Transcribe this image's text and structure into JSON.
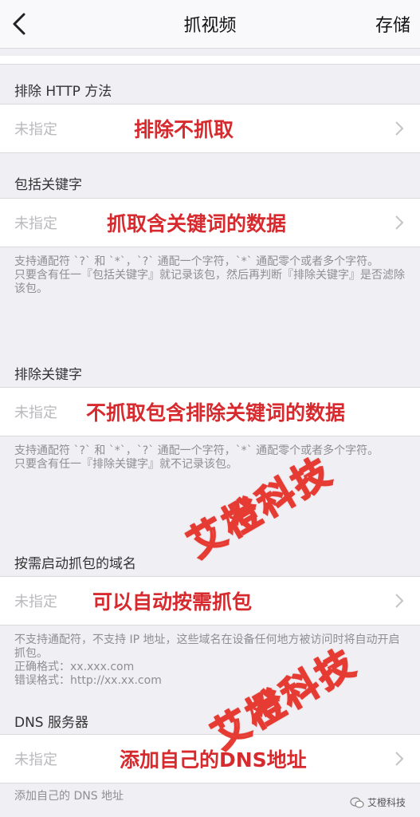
{
  "nav": {
    "title": "抓视频",
    "save_label": "存储"
  },
  "sections": [
    {
      "header": "排除 HTTP 方法",
      "placeholder": "未指定",
      "annotation": "排除不抓取",
      "note": ""
    },
    {
      "header": "包括关键字",
      "placeholder": "未指定",
      "annotation": "抓取含关键词的数据",
      "note": "支持通配符 `?` 和 `*`，`?` 通配一个字符，`*` 通配零个或者多个字符。\n只要含有任一『包括关键字』就记录该包，然后再判断『排除关键字』是否滤除该包。"
    },
    {
      "header": "排除关键字",
      "placeholder": "未指定",
      "annotation": "不抓取包含排除关键词的数据",
      "note": "支持通配符 `?` 和 `*`，`?` 通配一个字符，`*` 通配零个或者多个字符。\n只要含有任一『排除关键字』就不记录该包。"
    },
    {
      "header": "按需启动抓包的域名",
      "placeholder": "未指定",
      "annotation": "可以自动按需抓包",
      "note": "不支持通配符，不支持 IP 地址，这些域名在设备任何地方被访问时将自动开启抓包。\n正确格式：xx.xxx.com\n错误格式：http://xx.xx.com"
    },
    {
      "header": "DNS 服务器",
      "placeholder": "未指定",
      "annotation": "添加自己的DNS地址",
      "note": "添加自己的 DNS 地址"
    }
  ],
  "watermark": {
    "text": "艾橙科技"
  },
  "footer": {
    "brand": "艾橙科技"
  },
  "colors": {
    "annotation": "#d62a2e",
    "background": "#efeff4"
  }
}
